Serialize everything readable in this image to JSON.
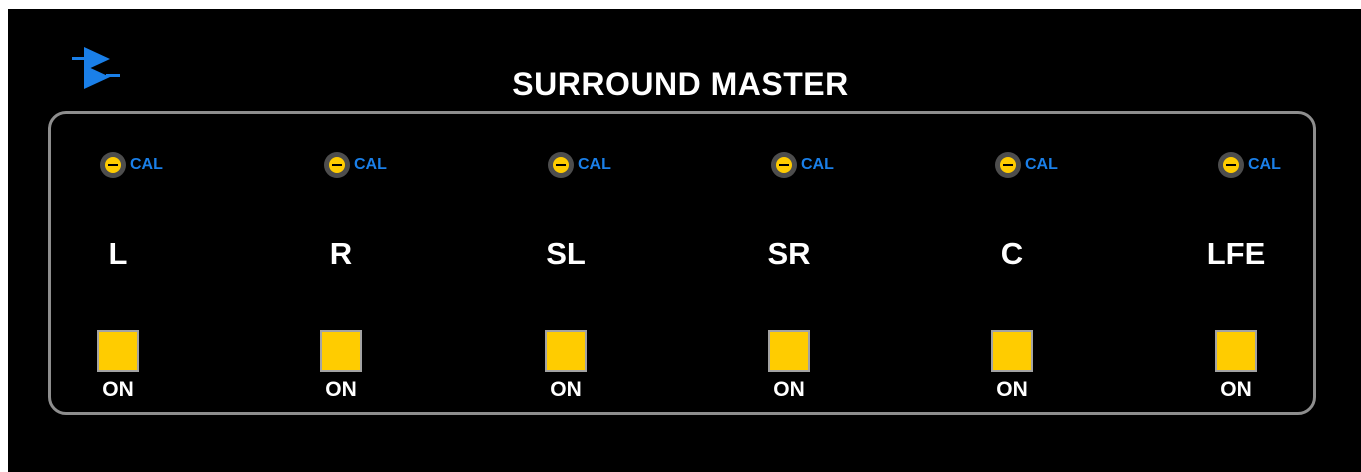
{
  "panel": {
    "title": "SURROUND MASTER",
    "logo_icon": "logo-arrows-icon",
    "accent_color": "#1a7fe8",
    "button_color": "#ffcc00",
    "channels": [
      {
        "name": "L",
        "cal_label": "CAL",
        "button_label": "ON",
        "state": "on"
      },
      {
        "name": "R",
        "cal_label": "CAL",
        "button_label": "ON",
        "state": "on"
      },
      {
        "name": "SL",
        "cal_label": "CAL",
        "button_label": "ON",
        "state": "on"
      },
      {
        "name": "SR",
        "cal_label": "CAL",
        "button_label": "ON",
        "state": "on"
      },
      {
        "name": "C",
        "cal_label": "CAL",
        "button_label": "ON",
        "state": "on"
      },
      {
        "name": "LFE",
        "cal_label": "CAL",
        "button_label": "ON",
        "state": "on"
      }
    ]
  }
}
